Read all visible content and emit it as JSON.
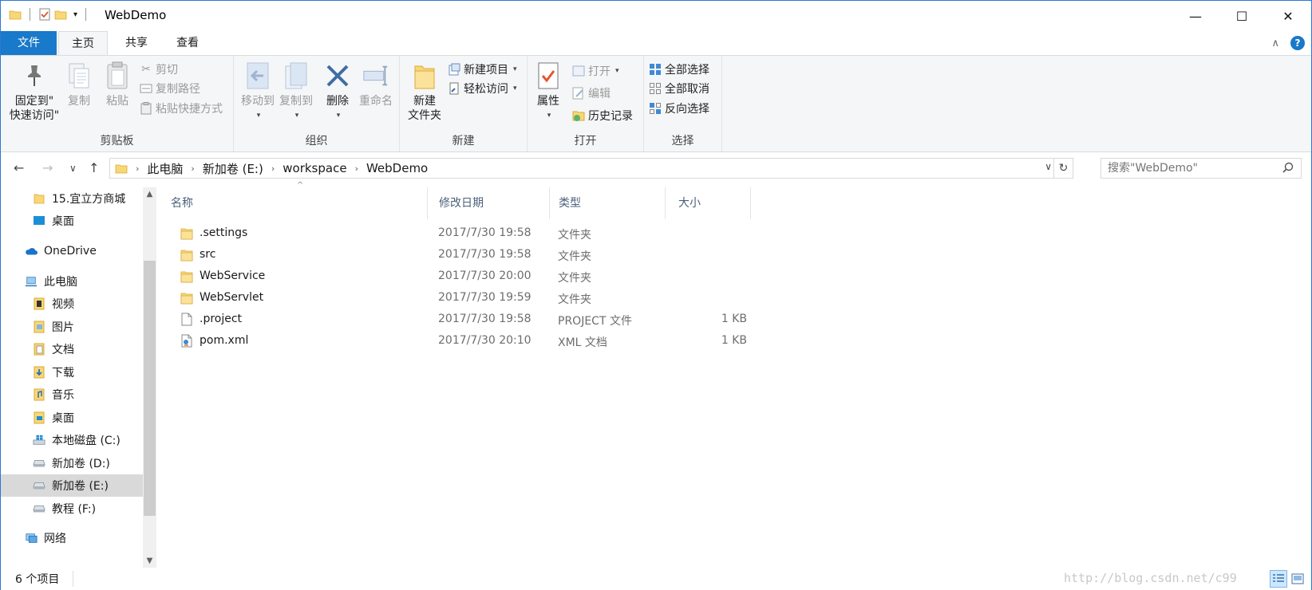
{
  "window": {
    "title": "WebDemo",
    "minimize": "—",
    "maximize": "☐",
    "close": "✕"
  },
  "tabs": {
    "file": "文件",
    "home": "主页",
    "share": "共享",
    "view": "查看"
  },
  "ribbon": {
    "clipboard": {
      "label": "剪贴板",
      "pin_line1": "固定到\"",
      "pin_line2": "快速访问\"",
      "copy": "复制",
      "paste": "粘贴",
      "cut": "剪切",
      "copy_path": "复制路径",
      "paste_shortcut": "粘贴快捷方式"
    },
    "organize": {
      "label": "组织",
      "move_to": "移动到",
      "copy_to": "复制到",
      "delete": "删除",
      "rename": "重命名"
    },
    "new": {
      "label": "新建",
      "new_folder_line1": "新建",
      "new_folder_line2": "文件夹",
      "new_item": "新建项目",
      "easy_access": "轻松访问"
    },
    "open": {
      "label": "打开",
      "properties": "属性",
      "open": "打开",
      "edit": "编辑",
      "history": "历史记录"
    },
    "select": {
      "label": "选择",
      "select_all": "全部选择",
      "select_none": "全部取消",
      "invert": "反向选择"
    }
  },
  "address": {
    "crumbs": [
      "此电脑",
      "新加卷 (E:)",
      "workspace",
      "WebDemo"
    ],
    "search_placeholder": "搜索\"WebDemo\""
  },
  "nav": {
    "items": [
      {
        "label": "15.宜立方商城",
        "icon": "folder-icon"
      },
      {
        "label": "桌面",
        "icon": "desktop-icon"
      },
      {
        "label": "OneDrive",
        "icon": "cloud-icon"
      },
      {
        "label": "此电脑",
        "icon": "computer-icon"
      },
      {
        "label": "视频",
        "icon": "video-folder-icon"
      },
      {
        "label": "图片",
        "icon": "pictures-folder-icon"
      },
      {
        "label": "文档",
        "icon": "documents-folder-icon"
      },
      {
        "label": "下载",
        "icon": "downloads-folder-icon"
      },
      {
        "label": "音乐",
        "icon": "music-folder-icon"
      },
      {
        "label": "桌面",
        "icon": "desktop-folder-icon"
      },
      {
        "label": "本地磁盘 (C:)",
        "icon": "windows-drive-icon"
      },
      {
        "label": "新加卷 (D:)",
        "icon": "drive-icon"
      },
      {
        "label": "新加卷 (E:)",
        "icon": "drive-icon"
      },
      {
        "label": "教程 (F:)",
        "icon": "drive-icon"
      },
      {
        "label": "网络",
        "icon": "network-icon"
      }
    ]
  },
  "columns": {
    "name": "名称",
    "date": "修改日期",
    "type": "类型",
    "size": "大小"
  },
  "files": [
    {
      "name": ".settings",
      "date": "2017/7/30 19:58",
      "type": "文件夹",
      "size": "",
      "icon": "folder-icon"
    },
    {
      "name": "src",
      "date": "2017/7/30 19:58",
      "type": "文件夹",
      "size": "",
      "icon": "folder-icon"
    },
    {
      "name": "WebService",
      "date": "2017/7/30 20:00",
      "type": "文件夹",
      "size": "",
      "icon": "folder-icon"
    },
    {
      "name": "WebServlet",
      "date": "2017/7/30 19:59",
      "type": "文件夹",
      "size": "",
      "icon": "folder-icon"
    },
    {
      "name": ".project",
      "date": "2017/7/30 19:58",
      "type": "PROJECT 文件",
      "size": "1 KB",
      "icon": "file-icon"
    },
    {
      "name": "pom.xml",
      "date": "2017/7/30 20:10",
      "type": "XML 文档",
      "size": "1 KB",
      "icon": "xml-file-icon"
    }
  ],
  "status": {
    "count": "6 个项目",
    "watermark": "http://blog.csdn.net/c99"
  },
  "colors": {
    "accent": "#1979ca",
    "folder": "#f8d775",
    "selected": "#d9d9d9"
  }
}
